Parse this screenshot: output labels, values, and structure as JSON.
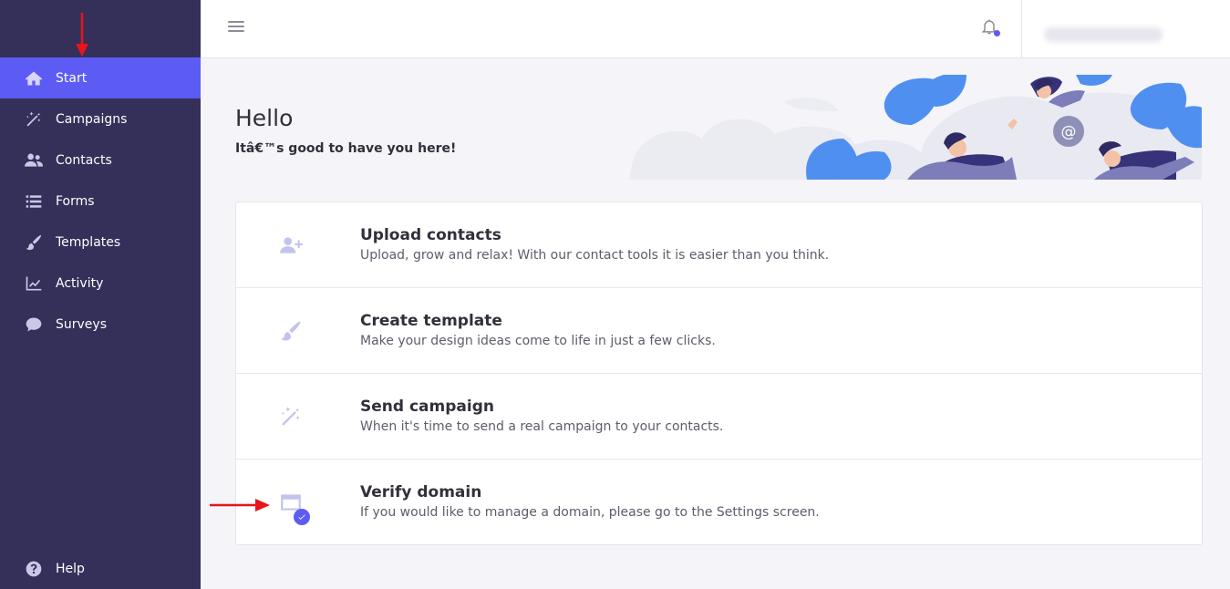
{
  "sidebar": {
    "items": [
      {
        "label": "Start",
        "icon": "home-icon",
        "active": true
      },
      {
        "label": "Campaigns",
        "icon": "magic-wand-icon"
      },
      {
        "label": "Contacts",
        "icon": "users-icon"
      },
      {
        "label": "Forms",
        "icon": "list-icon"
      },
      {
        "label": "Templates",
        "icon": "brush-icon"
      },
      {
        "label": "Activity",
        "icon": "chart-line-icon"
      },
      {
        "label": "Surveys",
        "icon": "chat-bubble-icon"
      }
    ],
    "help": {
      "label": "Help",
      "icon": "question-circle-icon"
    }
  },
  "topbar": {
    "menu_icon": "hamburger-icon",
    "notification_icon": "bell-icon"
  },
  "greeting": {
    "title": "Hello",
    "subtitle": "Itâ€™s good to have you here!"
  },
  "tasks": [
    {
      "title": "Upload contacts",
      "description": "Upload, grow and relax! With our contact tools it is easier than you think.",
      "icon": "user-plus-icon"
    },
    {
      "title": "Create template",
      "description": "Make your design ideas come to life in just a few clicks.",
      "icon": "brush-icon"
    },
    {
      "title": "Send campaign",
      "description": "When it's time to send a real campaign to your contacts.",
      "icon": "magic-wand-icon"
    },
    {
      "title": "Verify domain",
      "description": "If you would like to manage a domain, please go to the Settings screen.",
      "icon": "browser-window-icon",
      "completed": true
    }
  ],
  "colors": {
    "sidebar_bg": "#34305a",
    "accent": "#5c5cf5",
    "annotation": "#e8141b"
  }
}
